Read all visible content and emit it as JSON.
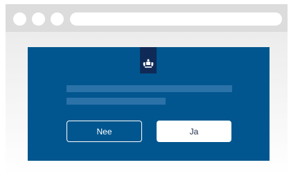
{
  "dialog": {
    "no_label": "Nee",
    "yes_label": "Ja"
  },
  "colors": {
    "panel": "#01568f",
    "logo_bg": "#0f2a56",
    "text_placeholder": "#2b72a8",
    "browser_frame": "#dcdcdc"
  },
  "icons": {
    "window_controls": [
      "window-dot-icon",
      "window-dot-icon",
      "window-dot-icon"
    ],
    "logo": "coat-of-arms-icon"
  }
}
